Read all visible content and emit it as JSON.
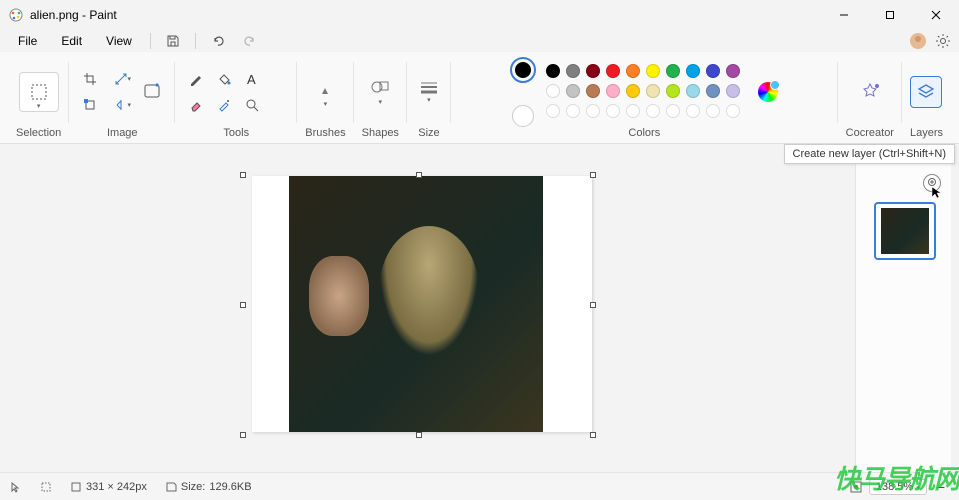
{
  "window": {
    "title": "alien.png - Paint"
  },
  "menus": {
    "file": "File",
    "edit": "Edit",
    "view": "View"
  },
  "ribbon": {
    "selection": "Selection",
    "image": "Image",
    "tools": "Tools",
    "brushes": "Brushes",
    "shapes": "Shapes",
    "size": "Size",
    "colors": "Colors",
    "cocreator": "Cocreator",
    "layers": "Layers"
  },
  "colors": {
    "row1": [
      "#000000",
      "#7f7f7f",
      "#880015",
      "#ed1c24",
      "#ff7f27",
      "#fff200",
      "#22b14c",
      "#00a2e8",
      "#3f48cc",
      "#a349a4"
    ],
    "row2": [
      "#ffffff",
      "#c3c3c3",
      "#b97a57",
      "#ffaec9",
      "#ffc90e",
      "#efe4b0",
      "#b5e61d",
      "#99d9ea",
      "#7092be",
      "#c8bfe7"
    ]
  },
  "tooltip": "Create new layer (Ctrl+Shift+N)",
  "status": {
    "dimensions": "331 × 242px",
    "size_label": "Size:",
    "size_value": "129.6KB",
    "zoom": "138.5%"
  },
  "watermark": "快马导航网"
}
